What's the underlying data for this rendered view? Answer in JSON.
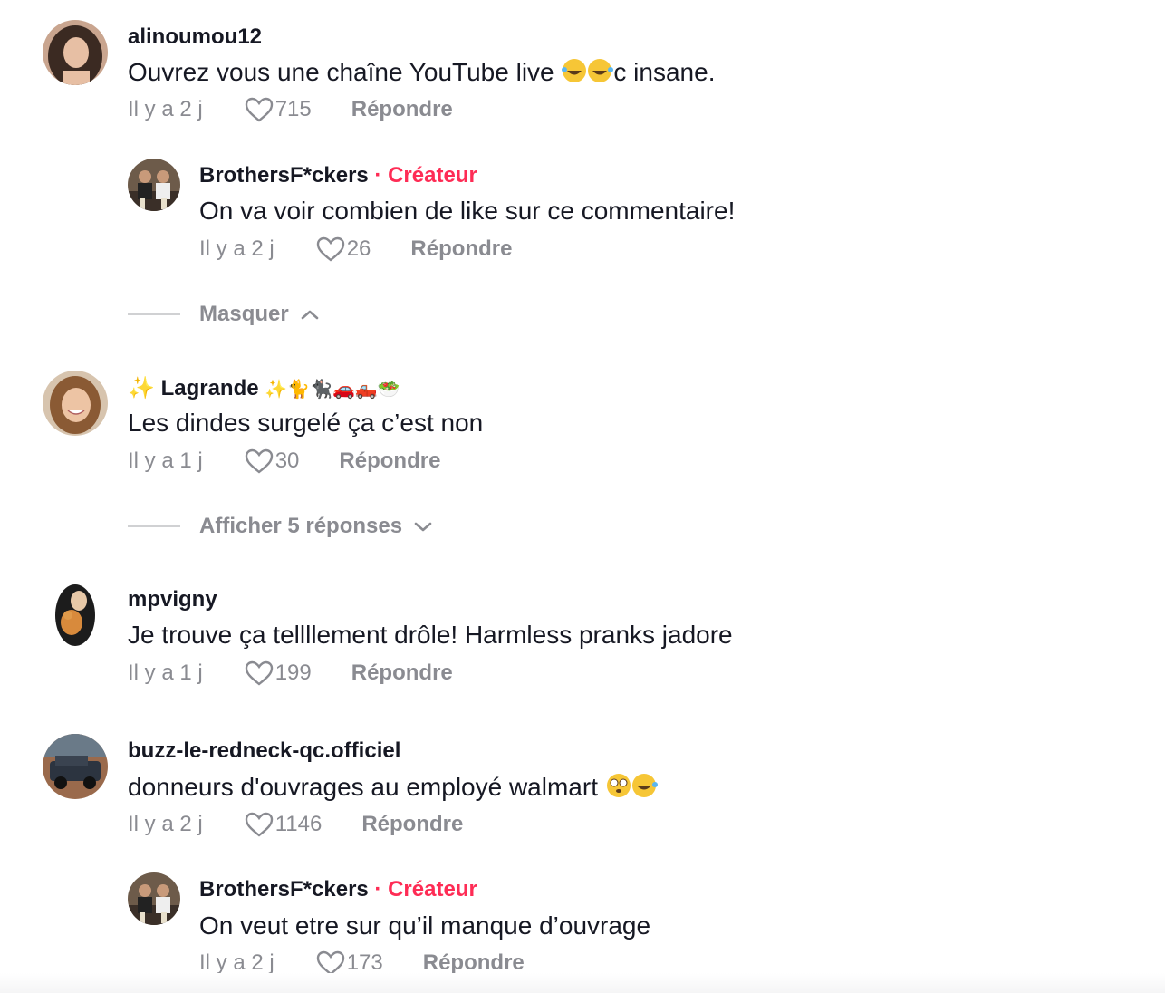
{
  "comments": [
    {
      "username": "alinoumou12",
      "text": "Ouvrez vous une chaîne YouTube live ",
      "text_tail": "c insane.",
      "time": "Il y a 2 j",
      "likes": "715",
      "reply_label": "Répondre",
      "replies": [
        {
          "username": "BrothersF*ckers",
          "separator": "·",
          "badge": "Créateur",
          "text": "On va voir combien de like sur ce commentaire!",
          "time": "Il y a 2 j",
          "likes": "26",
          "reply_label": "Répondre"
        }
      ],
      "toggle_label": "Masquer"
    },
    {
      "username_prefix": "✨",
      "username": "Lagrande",
      "username_suffix": "✨🐈🐈‍⬛🚗🛻🥗",
      "text": "Les dindes surgelé ça c’est non",
      "time": "Il y a 1 j",
      "likes": "30",
      "reply_label": "Répondre",
      "toggle_label": "Afficher 5 réponses"
    },
    {
      "username": "mpvigny",
      "text": "Je trouve ça tellllement drôle! Harmless pranks jadore",
      "time": "Il y a 1 j",
      "likes": "199",
      "reply_label": "Répondre"
    },
    {
      "username": "buzz-le-redneck-qc.officiel",
      "text": "donneurs d'ouvrages au employé walmart ",
      "time": "Il y a 2 j",
      "likes": "1146",
      "reply_label": "Répondre",
      "replies": [
        {
          "username": "BrothersF*ckers",
          "separator": "·",
          "badge": "Créateur",
          "text": "On veut etre sur qu’il manque d’ouvrage",
          "time": "Il y a 2 j",
          "likes": "173",
          "reply_label": "Répondre"
        }
      ]
    }
  ],
  "icons": {
    "like": "heart-outline-icon",
    "collapse": "chevron-up-icon",
    "expand": "chevron-down-icon",
    "laugh_emoji": "tears-of-joy-emoji",
    "flushed_emoji": "flushed-face-emoji"
  },
  "colors": {
    "text": "#161823",
    "secondary": "#8a8b91",
    "creator_badge": "#fe2c55",
    "divider": "#d0d1d3"
  }
}
